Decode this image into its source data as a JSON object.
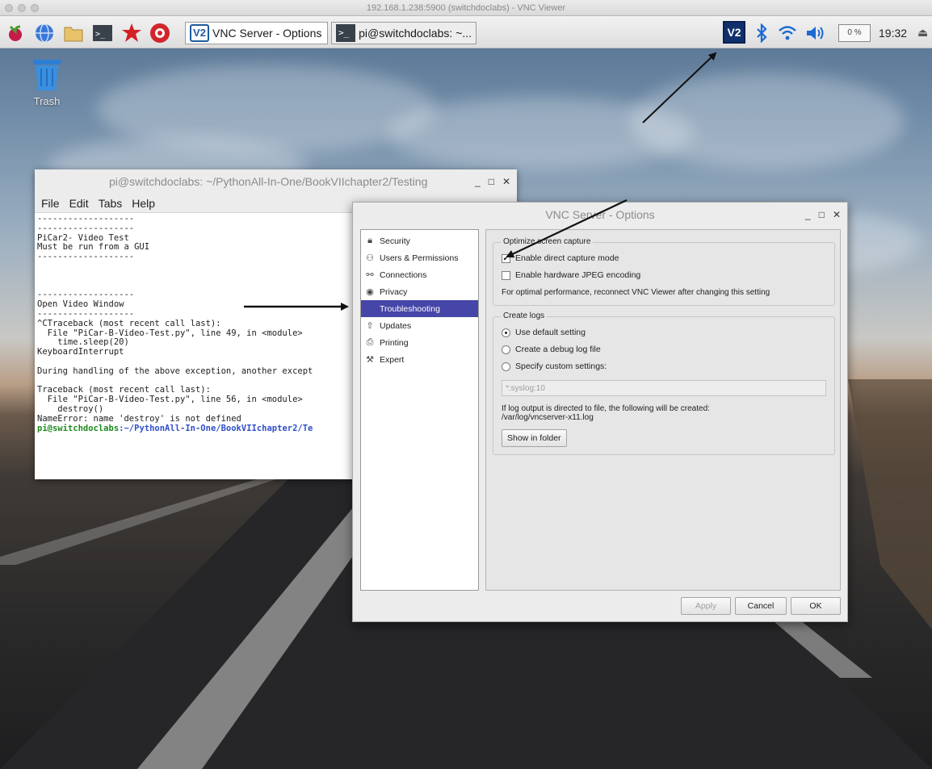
{
  "viewer": {
    "title": "192.168.1.238:5900 (switchdoclabs) - VNC Viewer"
  },
  "taskbar": {
    "launchers": [
      "raspberry-menu-icon",
      "web-browser-icon",
      "file-manager-icon",
      "terminal-icon",
      "mathematica-icon",
      "wolfram-icon"
    ],
    "tasks": [
      {
        "label": "VNC Server - Options",
        "icon": "vnc-logo-icon",
        "active": true
      },
      {
        "label": "pi@switchdoclabs: ~...",
        "icon": "terminal-icon",
        "active": false
      }
    ],
    "tray": {
      "vnc_icon": "V2",
      "cpu": "0 %",
      "clock": "19:32"
    }
  },
  "desktop": {
    "trash_label": "Trash"
  },
  "terminal": {
    "title": "pi@switchdoclabs: ~/PythonAll-In-One/BookVIIchapter2/Testing",
    "menu": [
      "File",
      "Edit",
      "Tabs",
      "Help"
    ],
    "lines": [
      "-------------------",
      "-------------------",
      "PiCar2- Video Test",
      "Must be run from a GUI",
      "-------------------",
      "",
      "",
      "",
      "-------------------",
      "Open Video Window",
      "-------------------",
      "^CTraceback (most recent call last):",
      "  File \"PiCar-B-Video-Test.py\", line 49, in <module>",
      "    time.sleep(20)",
      "KeyboardInterrupt",
      "",
      "During handling of the above exception, another except",
      "",
      "Traceback (most recent call last):",
      "  File \"PiCar-B-Video-Test.py\", line 56, in <module>",
      "    destroy()",
      "NameError: name 'destroy' is not defined"
    ],
    "prompt_user": "pi@switchdoclabs",
    "prompt_path": ":~/PythonAll-In-One/BookVIIchapter2/Te"
  },
  "dialog": {
    "title": "VNC Server - Options",
    "categories": [
      {
        "label": "Security",
        "icon": "lock-icon"
      },
      {
        "label": "Users & Permissions",
        "icon": "users-icon"
      },
      {
        "label": "Connections",
        "icon": "connections-icon"
      },
      {
        "label": "Privacy",
        "icon": "eye-icon"
      },
      {
        "label": "Troubleshooting",
        "icon": "tools-icon",
        "selected": true
      },
      {
        "label": "Updates",
        "icon": "updates-icon"
      },
      {
        "label": "Printing",
        "icon": "printer-icon"
      },
      {
        "label": "Expert",
        "icon": "wrench-icon"
      }
    ],
    "capture": {
      "title": "Optimize screen capture",
      "enable_direct": {
        "label": "Enable direct capture mode",
        "checked": true
      },
      "enable_jpeg": {
        "label": "Enable hardware JPEG encoding",
        "checked": false
      },
      "note": "For optimal performance, reconnect VNC Viewer after changing this setting"
    },
    "logs": {
      "title": "Create logs",
      "options": [
        {
          "label": "Use default setting",
          "selected": true
        },
        {
          "label": "Create a debug log file",
          "selected": false
        },
        {
          "label": "Specify custom settings:",
          "selected": false
        }
      ],
      "custom_value": "*:syslog:10",
      "info_line1": "If log output is directed to file, the following will be created:",
      "info_line2": "/var/log/vncserver-x11.log",
      "show_folder": "Show in folder"
    },
    "buttons": {
      "apply": "Apply",
      "cancel": "Cancel",
      "ok": "OK"
    }
  }
}
